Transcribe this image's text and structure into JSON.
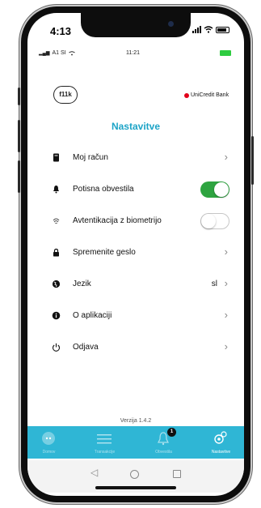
{
  "device": {
    "time": "4:13"
  },
  "app_status": {
    "carrier": "A1 SI",
    "time": "11:21"
  },
  "header": {
    "logo_left_text": "f11k",
    "bank_name": "UniCredit Bank",
    "title": "Nastavitve"
  },
  "menu": {
    "items": [
      {
        "label": "Moj račun",
        "icon": "document-icon",
        "trailing": "chevron"
      },
      {
        "label": "Potisna obvestila",
        "icon": "bell-icon",
        "trailing": "toggle",
        "toggle_on": true
      },
      {
        "label": "Avtentikacija z biometrijo",
        "icon": "fingerprint-icon",
        "trailing": "toggle",
        "toggle_on": false
      },
      {
        "label": "Spremenite geslo",
        "icon": "lock-icon",
        "trailing": "chevron"
      },
      {
        "label": "Jezik",
        "icon": "globe-icon",
        "trailing": "chevron",
        "value": "sl"
      },
      {
        "label": "O aplikaciji",
        "icon": "info-icon",
        "trailing": "chevron"
      },
      {
        "label": "Odjava",
        "icon": "power-icon",
        "trailing": "chevron"
      }
    ]
  },
  "footer": {
    "version": "Verzija 1.4.2"
  },
  "tabbar": {
    "tabs": [
      {
        "label": "Domov",
        "icon": "home-icon",
        "active": false
      },
      {
        "label": "Transakcije",
        "icon": "list-icon",
        "active": false
      },
      {
        "label": "Obvestila",
        "icon": "bell-icon",
        "active": false,
        "badge": "1"
      },
      {
        "label": "Nastavitve",
        "icon": "gear-icon",
        "active": true
      }
    ]
  },
  "colors": {
    "accent": "#1da4c7",
    "tabbar": "#2fb6d5",
    "toggle_on": "#2ea440",
    "brand_red": "#e2001a"
  }
}
